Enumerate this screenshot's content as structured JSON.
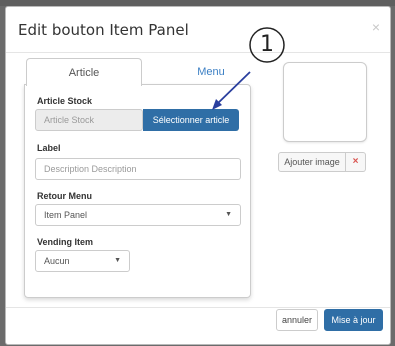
{
  "modal": {
    "title": "Edit bouton Item Panel",
    "close_symbol": "×",
    "tabs": [
      {
        "label": "Article",
        "active": true
      },
      {
        "label": "Menu",
        "active": false
      }
    ],
    "form": {
      "article_stock": {
        "label": "Article Stock",
        "value": "Article Stock",
        "button": "Sélectionner article"
      },
      "label_field": {
        "label": "Label",
        "placeholder": "Description Description"
      },
      "retour_menu": {
        "label": "Retour Menu",
        "selected": "Item Panel"
      },
      "vending_item": {
        "label": "Vending Item",
        "selected": "Aucun"
      }
    },
    "image": {
      "add_button": "Ajouter image",
      "remove_symbol": "×"
    },
    "footer": {
      "cancel": "annuler",
      "save": "Mise à jour"
    }
  },
  "annotation": {
    "number": "1"
  },
  "colors": {
    "primary": "#2f6ea6",
    "link": "#3b7fc4",
    "danger": "#d9534f",
    "backdrop": "#6b6b6b"
  }
}
